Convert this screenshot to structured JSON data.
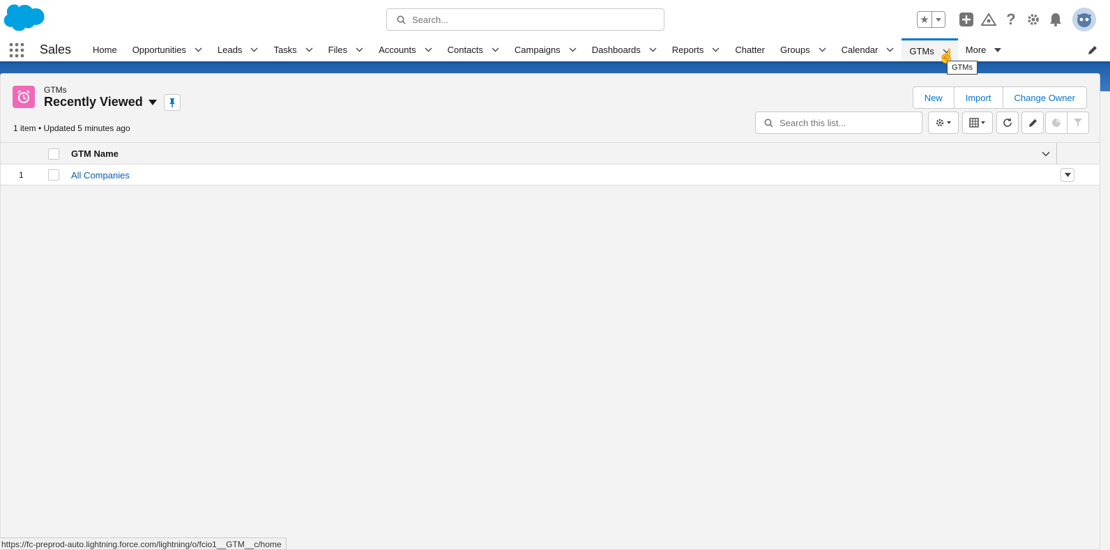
{
  "header": {
    "search_placeholder": "Search...",
    "icons": [
      "favorites-star-icon",
      "add-icon",
      "trailhead-icon",
      "help-icon",
      "setup-gear-icon",
      "notifications-bell-icon",
      "avatar"
    ]
  },
  "nav": {
    "app_name": "Sales",
    "items": [
      {
        "label": "Home",
        "has_menu": false
      },
      {
        "label": "Opportunities",
        "has_menu": true
      },
      {
        "label": "Leads",
        "has_menu": true
      },
      {
        "label": "Tasks",
        "has_menu": true
      },
      {
        "label": "Files",
        "has_menu": true
      },
      {
        "label": "Accounts",
        "has_menu": true
      },
      {
        "label": "Contacts",
        "has_menu": true
      },
      {
        "label": "Campaigns",
        "has_menu": true
      },
      {
        "label": "Dashboards",
        "has_menu": true
      },
      {
        "label": "Reports",
        "has_menu": true
      },
      {
        "label": "Chatter",
        "has_menu": false
      },
      {
        "label": "Groups",
        "has_menu": true
      },
      {
        "label": "Calendar",
        "has_menu": true
      },
      {
        "label": "GTMs",
        "has_menu": true,
        "active": true
      },
      {
        "label": "More",
        "has_menu": true
      }
    ],
    "tooltip": "GTMs"
  },
  "list_view": {
    "object_label": "GTMs",
    "view_name": "Recently Viewed",
    "meta": "1 item • Updated 5 minutes ago",
    "actions": [
      "New",
      "Import",
      "Change Owner"
    ],
    "search_placeholder": "Search this list...",
    "columns": [
      "GTM Name"
    ],
    "rows": [
      {
        "num": "1",
        "name": "All Companies"
      }
    ]
  },
  "status_bar": {
    "url": "https://fc-preprod-auto.lightning.force.com/lightning/o/fcio1__GTM__c/home"
  },
  "colors": {
    "brand_blue": "#0176d3",
    "link_blue": "#0b5cab",
    "object_icon": "#f268b9",
    "banner": "#1c5ea8"
  }
}
